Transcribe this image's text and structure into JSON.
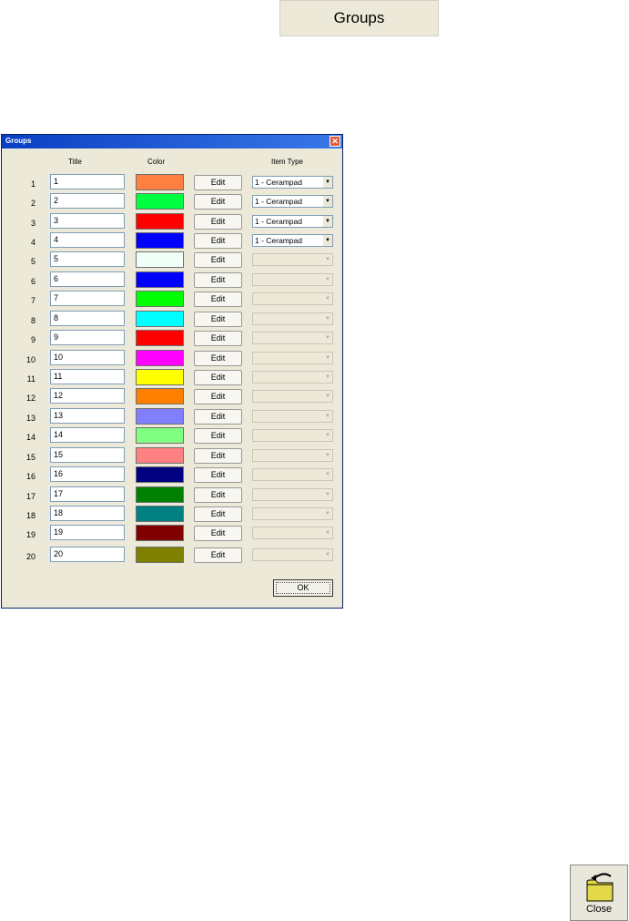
{
  "groups_button": {
    "label": "Groups"
  },
  "dialog": {
    "title": "Groups",
    "close_glyph": "✕",
    "headers": {
      "title": "Title",
      "color": "Color",
      "item_type": "Item Type"
    },
    "edit_label": "Edit",
    "ok_label": "OK",
    "rows": [
      {
        "num": "1",
        "title": "1",
        "color": "#ff8040",
        "item_type": "1 - Cerampad",
        "enabled": true
      },
      {
        "num": "2",
        "title": "2",
        "color": "#00ff40",
        "item_type": "1 - Cerampad",
        "enabled": true
      },
      {
        "num": "3",
        "title": "3",
        "color": "#ff0000",
        "item_type": "1 - Cerampad",
        "enabled": true
      },
      {
        "num": "4",
        "title": "4",
        "color": "#0000ff",
        "item_type": "1 - Cerampad",
        "enabled": true
      },
      {
        "num": "5",
        "title": "5",
        "color": "#f0fff8",
        "item_type": "",
        "enabled": false
      },
      {
        "num": "6",
        "title": "6",
        "color": "#0000ff",
        "item_type": "",
        "enabled": false
      },
      {
        "num": "7",
        "title": "7",
        "color": "#00ff00",
        "item_type": "",
        "enabled": false
      },
      {
        "num": "8",
        "title": "8",
        "color": "#00ffff",
        "item_type": "",
        "enabled": false
      },
      {
        "num": "9",
        "title": "9",
        "color": "#ff0000",
        "item_type": "",
        "enabled": false
      },
      {
        "num": "10",
        "title": "10",
        "color": "#ff00ff",
        "item_type": "",
        "enabled": false
      },
      {
        "num": "11",
        "title": "11",
        "color": "#ffff00",
        "item_type": "",
        "enabled": false
      },
      {
        "num": "12",
        "title": "12",
        "color": "#ff8000",
        "item_type": "",
        "enabled": false
      },
      {
        "num": "13",
        "title": "13",
        "color": "#8080ff",
        "item_type": "",
        "enabled": false
      },
      {
        "num": "14",
        "title": "14",
        "color": "#80ff80",
        "item_type": "",
        "enabled": false
      },
      {
        "num": "15",
        "title": "15",
        "color": "#ff8080",
        "item_type": "",
        "enabled": false
      },
      {
        "num": "16",
        "title": "16",
        "color": "#000080",
        "item_type": "",
        "enabled": false
      },
      {
        "num": "17",
        "title": "17",
        "color": "#008000",
        "item_type": "",
        "enabled": false
      },
      {
        "num": "18",
        "title": "18",
        "color": "#008080",
        "item_type": "",
        "enabled": false
      },
      {
        "num": "19",
        "title": "19",
        "color": "#800000",
        "item_type": "",
        "enabled": false
      },
      {
        "num": "20",
        "title": "20",
        "color": "#808000",
        "item_type": "",
        "enabled": false
      }
    ]
  },
  "close_button": {
    "label": "Close",
    "icon": "folder-close-icon"
  }
}
